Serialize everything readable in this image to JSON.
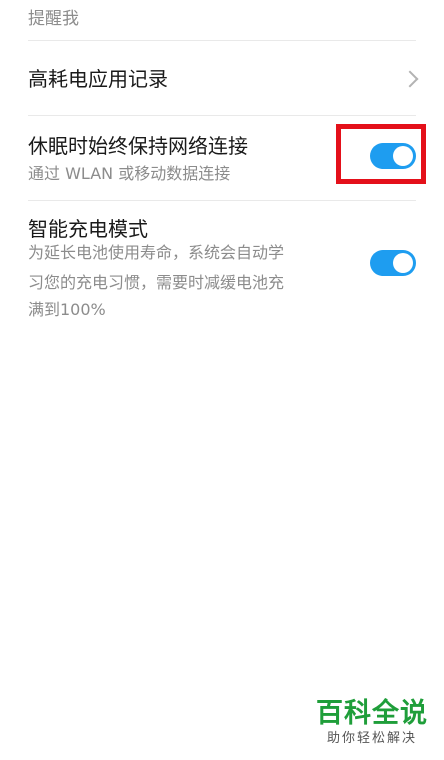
{
  "partial_row": {
    "text": "提醒我"
  },
  "settings": {
    "high_power_record": {
      "title": "高耗电应用记录"
    },
    "sleep_network": {
      "title": "休眠时始终保持网络连接",
      "subtitle": "通过 WLAN 或移动数据连接",
      "enabled": true
    },
    "smart_charging": {
      "title": "智能充电模式",
      "subtitle_line1": "为延长电池使用寿命，系统会自动学",
      "subtitle_line2": "习您的充电习惯，需要时减缓电池充",
      "subtitle_line3": "满到100%",
      "enabled": true
    }
  },
  "watermark": {
    "title": "百科全说",
    "subtitle": "助你轻松解决"
  },
  "colors": {
    "toggle_on": "#1e9df0",
    "highlight": "#e4101a",
    "watermark_green": "#1f9e3a"
  }
}
